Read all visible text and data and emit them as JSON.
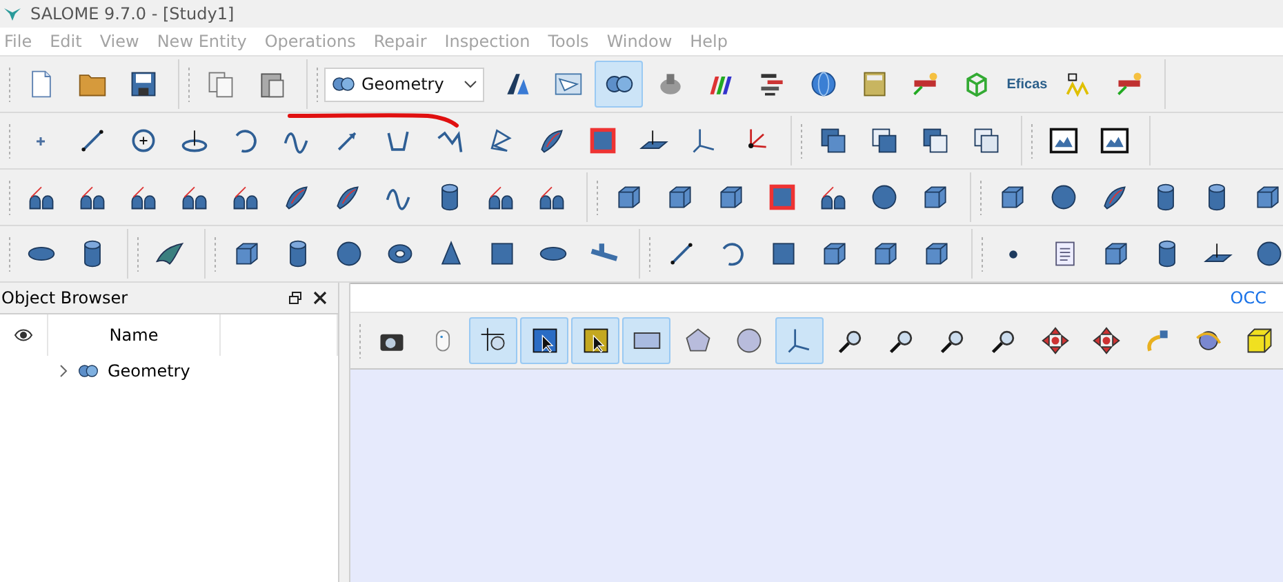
{
  "window": {
    "title": "SALOME 9.7.0 - [Study1]"
  },
  "menu": [
    "File",
    "Edit",
    "View",
    "New Entity",
    "Operations",
    "Repair",
    "Inspection",
    "Tools",
    "Window",
    "Help"
  ],
  "toolbars": [
    {
      "groups": [
        {
          "buttons": [
            {
              "kind": "icon",
              "selected": false
            },
            {
              "kind": "icon",
              "selected": false
            },
            {
              "kind": "icon",
              "selected": false
            }
          ]
        },
        {
          "buttons": [
            {
              "kind": "icon",
              "selected": false
            },
            {
              "kind": "icon",
              "selected": false
            }
          ]
        },
        {
          "module_selector": {
            "value": "Geometry"
          },
          "buttons": [
            {
              "kind": "icon",
              "selected": false
            },
            {
              "kind": "icon",
              "selected": false
            },
            {
              "kind": "icon",
              "selected": true
            },
            {
              "kind": "icon",
              "selected": false
            },
            {
              "kind": "icon",
              "selected": false
            },
            {
              "kind": "icon",
              "selected": false
            },
            {
              "kind": "icon",
              "selected": false
            },
            {
              "kind": "icon",
              "selected": false
            },
            {
              "kind": "icon",
              "selected": false
            },
            {
              "kind": "icon",
              "selected": false
            },
            {
              "kind": "logo",
              "label": "Eficas",
              "selected": false
            },
            {
              "kind": "icon",
              "selected": false
            },
            {
              "kind": "icon",
              "selected": false
            }
          ]
        }
      ]
    },
    {
      "groups": [
        {
          "buttons": [
            {
              "kind": "icon",
              "selected": false
            },
            {
              "kind": "icon",
              "selected": false
            },
            {
              "kind": "icon",
              "selected": false
            },
            {
              "kind": "icon",
              "selected": false
            },
            {
              "kind": "icon",
              "selected": false
            },
            {
              "kind": "icon",
              "selected": false
            },
            {
              "kind": "icon",
              "selected": false
            },
            {
              "kind": "icon",
              "selected": false
            },
            {
              "kind": "icon",
              "selected": false
            },
            {
              "kind": "icon",
              "selected": false
            },
            {
              "kind": "icon",
              "selected": false
            },
            {
              "kind": "icon",
              "selected": false
            },
            {
              "kind": "icon",
              "selected": false
            },
            {
              "kind": "icon",
              "selected": false
            },
            {
              "kind": "icon",
              "selected": false
            }
          ]
        },
        {
          "buttons": [
            {
              "kind": "icon",
              "selected": false
            },
            {
              "kind": "icon",
              "selected": false
            },
            {
              "kind": "icon",
              "selected": false
            },
            {
              "kind": "icon",
              "selected": false
            }
          ]
        },
        {
          "buttons": [
            {
              "kind": "icon",
              "selected": false
            },
            {
              "kind": "icon",
              "selected": false
            }
          ]
        }
      ]
    },
    {
      "groups": [
        {
          "buttons": [
            {
              "kind": "icon",
              "selected": false
            },
            {
              "kind": "icon",
              "selected": false
            },
            {
              "kind": "icon",
              "selected": false
            },
            {
              "kind": "icon",
              "selected": false
            },
            {
              "kind": "icon",
              "selected": false
            },
            {
              "kind": "icon",
              "selected": false
            },
            {
              "kind": "icon",
              "selected": false
            },
            {
              "kind": "icon",
              "selected": false
            },
            {
              "kind": "icon",
              "selected": false
            },
            {
              "kind": "icon",
              "selected": false
            },
            {
              "kind": "icon",
              "selected": false
            }
          ]
        },
        {
          "buttons": [
            {
              "kind": "icon",
              "selected": false
            },
            {
              "kind": "icon",
              "selected": false
            },
            {
              "kind": "icon",
              "selected": false
            },
            {
              "kind": "icon",
              "selected": false
            },
            {
              "kind": "icon",
              "selected": false
            },
            {
              "kind": "icon",
              "selected": false
            },
            {
              "kind": "icon",
              "selected": false
            }
          ]
        },
        {
          "buttons": [
            {
              "kind": "icon",
              "selected": false
            },
            {
              "kind": "icon",
              "selected": false
            },
            {
              "kind": "icon",
              "selected": false
            },
            {
              "kind": "icon",
              "selected": false
            },
            {
              "kind": "icon",
              "selected": false
            },
            {
              "kind": "icon",
              "selected": false
            }
          ]
        }
      ]
    },
    {
      "groups": [
        {
          "buttons": [
            {
              "kind": "icon",
              "selected": false
            },
            {
              "kind": "icon",
              "selected": false
            }
          ]
        },
        {
          "buttons": [
            {
              "kind": "icon",
              "selected": false
            }
          ]
        },
        {
          "buttons": [
            {
              "kind": "icon",
              "selected": false
            },
            {
              "kind": "icon",
              "selected": false
            },
            {
              "kind": "icon",
              "selected": false
            },
            {
              "kind": "icon",
              "selected": false
            },
            {
              "kind": "icon",
              "selected": false
            },
            {
              "kind": "icon",
              "selected": false
            },
            {
              "kind": "icon",
              "selected": false
            },
            {
              "kind": "icon",
              "selected": false
            }
          ]
        },
        {
          "buttons": [
            {
              "kind": "icon",
              "selected": false
            },
            {
              "kind": "icon",
              "selected": false
            },
            {
              "kind": "icon",
              "selected": false
            },
            {
              "kind": "icon",
              "selected": false
            },
            {
              "kind": "icon",
              "selected": false
            },
            {
              "kind": "icon",
              "selected": false
            }
          ]
        },
        {
          "buttons": [
            {
              "kind": "icon",
              "selected": false
            },
            {
              "kind": "icon",
              "selected": false
            },
            {
              "kind": "icon",
              "selected": false
            },
            {
              "kind": "icon",
              "selected": false
            },
            {
              "kind": "icon",
              "selected": false
            },
            {
              "kind": "icon",
              "selected": false
            }
          ]
        }
      ]
    }
  ],
  "object_browser": {
    "title": "Object Browser",
    "columns": [
      "Name"
    ],
    "tree": [
      {
        "label": "Geometry",
        "expanded": false
      }
    ]
  },
  "viewer": {
    "title": "OCC",
    "toolbar": [
      {
        "selected": false
      },
      {
        "selected": false
      },
      {
        "selected": true
      },
      {
        "selected": true
      },
      {
        "selected": true
      },
      {
        "selected": true
      },
      {
        "selected": false
      },
      {
        "selected": false
      },
      {
        "selected": true
      },
      {
        "selected": false
      },
      {
        "selected": false
      },
      {
        "selected": false
      },
      {
        "selected": false
      },
      {
        "selected": false
      },
      {
        "selected": false
      },
      {
        "selected": false
      },
      {
        "selected": false
      },
      {
        "selected": false
      }
    ]
  }
}
